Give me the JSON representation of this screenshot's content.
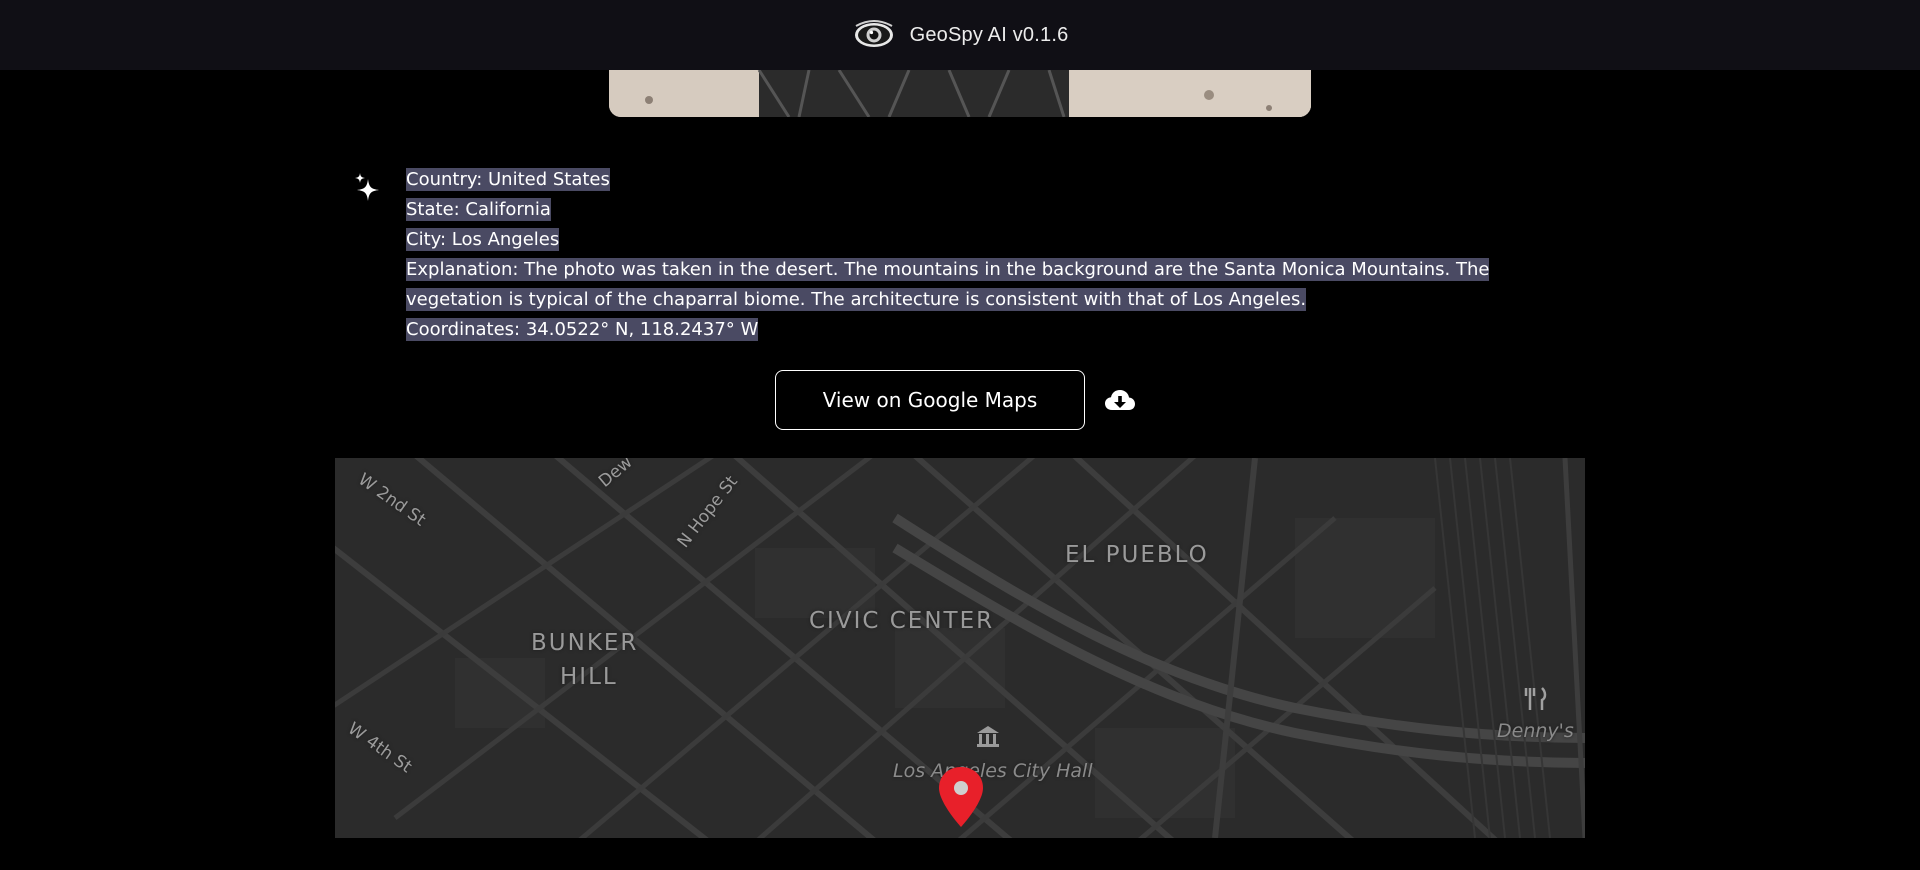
{
  "header": {
    "app_title": "GeoSpy AI v0.1.6",
    "logo_icon": "eye-icon"
  },
  "result": {
    "icon": "sparkle-icon",
    "lines": [
      " Country: United States",
      "State: California",
      "City: Los Angeles",
      "Explanation: The photo was taken in the desert. The mountains in the background are the Santa Monica Mountains. The vegetation is typical of the chaparral biome. The architecture is consistent with that of Los Angeles.",
      "Coordinates: 34.0522° N, 118.2437° W"
    ]
  },
  "actions": {
    "maps_button_label": "View on Google Maps",
    "download_icon": "cloud-download-icon"
  },
  "map": {
    "districts": {
      "bunker_hill_1": "BUNKER",
      "bunker_hill_2": "HILL",
      "civic_center": "CIVIC CENTER",
      "el_pueblo": "EL PUEBLO"
    },
    "streets": {
      "w_2nd": "W 2nd St",
      "w_4th": "W 4th St",
      "n_hope": "N Hope St",
      "dew": "Dew"
    },
    "pois": {
      "city_hall": "Los Angeles City Hall",
      "dennys": "Denny's"
    },
    "marker_icon": "location-pin-icon",
    "colors": {
      "background": "#2b2b2b",
      "road": "#3d3d3d",
      "marker": "#e8202a"
    }
  },
  "colors": {
    "highlight": "#4a4a63",
    "topbar": "#100f15"
  }
}
